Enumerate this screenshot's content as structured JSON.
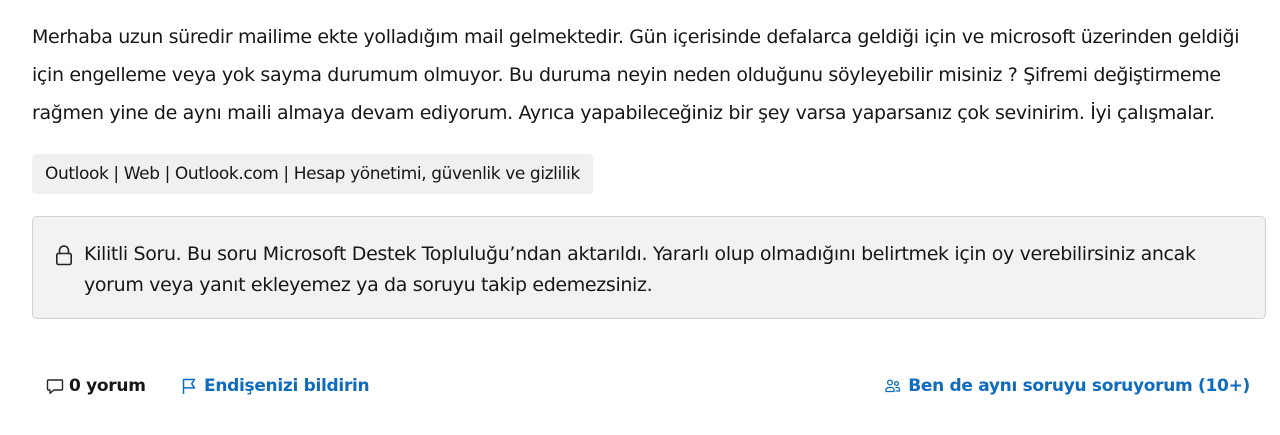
{
  "question": {
    "body": "Merhaba uzun süredir mailime ekte yolladığım mail gelmektedir. Gün içerisinde defalarca geldiği için ve microsoft üzerinden geldiği için engelleme veya yok sayma durumum olmuyor. Bu duruma neyin neden olduğunu söyleyebilir misiniz ? Şifremi değiştirmeme rağmen yine de aynı maili almaya devam ediyorum. Ayrıca yapabileceğiniz bir şey varsa yaparsanız çok sevinirim. İyi çalışmalar."
  },
  "tags": {
    "label": "Outlook | Web | Outlook.com | Hesap yönetimi, güvenlik ve gizlilik"
  },
  "locked_notice": {
    "icon": "lock-icon",
    "text": "Kilitli Soru. Bu soru Microsoft Destek Topluluğu’ndan aktarıldı. Yararlı olup olmadığını belirtmek için oy verebilirsiniz ancak yorum veya yanıt ekleyemez ya da soruyu takip edemezsiniz."
  },
  "actions": {
    "comments": {
      "icon": "comment-icon",
      "label": "0 yorum"
    },
    "report": {
      "icon": "flag-icon",
      "label": "Endişenizi bildirin"
    },
    "same_question": {
      "icon": "people-icon",
      "label": "Ben de aynı soruyu soruyorum (10+)"
    }
  },
  "colors": {
    "text": "#161616",
    "link": "#0f6cbd",
    "tag_background": "#f0f0f0",
    "notice_background": "#f2f2f2",
    "notice_border": "#d1d1d1"
  }
}
